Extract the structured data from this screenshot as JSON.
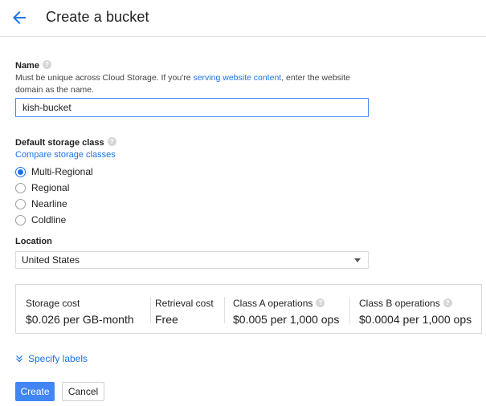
{
  "header": {
    "title": "Create a bucket",
    "back_icon": "arrow-back-icon"
  },
  "name": {
    "label": "Name",
    "help_text_before": "Must be unique across Cloud Storage. If you're ",
    "help_link": "serving website content",
    "help_text_after": ", enter the website domain as the name.",
    "value": "kish-bucket"
  },
  "storage_class": {
    "label": "Default storage class",
    "compare_link": "Compare storage classes",
    "options": [
      "Multi-Regional",
      "Regional",
      "Nearline",
      "Coldline"
    ],
    "selected": "Multi-Regional"
  },
  "location": {
    "label": "Location",
    "value": "United States"
  },
  "costs": [
    {
      "title": "Storage cost",
      "value": "$0.026 per GB-month"
    },
    {
      "title": "Retrieval cost",
      "value": "Free"
    },
    {
      "title": "Class A operations",
      "value": "$0.005 per 1,000 ops"
    },
    {
      "title": "Class B operations",
      "value": "$0.0004 per 1,000 ops"
    }
  ],
  "labels_toggle": "Specify labels",
  "buttons": {
    "create": "Create",
    "cancel": "Cancel"
  },
  "colors": {
    "accent": "#1a73e8",
    "primary_button": "#4285f4"
  }
}
